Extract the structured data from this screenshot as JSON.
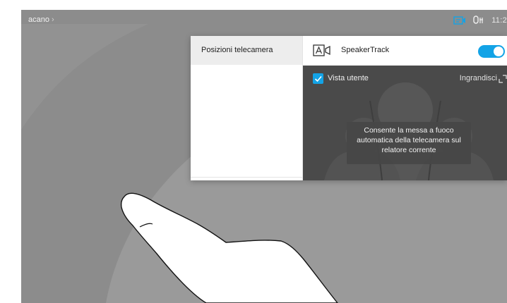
{
  "topbar": {
    "breadcrumb": "acano",
    "breadcrumb_chevron": "›",
    "time": "11:2",
    "icons": [
      "screen-share-icon",
      "mic-status-icon"
    ]
  },
  "panel": {
    "left_item": "Posizioni telecamera",
    "speakertrack": {
      "label": "SpeakerTrack",
      "enabled": true,
      "icon": "camera-tracking-icon"
    },
    "preview": {
      "checkbox_label": "Vista utente",
      "checked": true,
      "zoom_label": "Ingrandisci",
      "tooltip": "Consente la messa a fuoco automatica della telecamera sul relatore corrente"
    }
  },
  "colors": {
    "accent": "#13a3e6",
    "screen_bg": "#8a8a8a",
    "preview_bg": "#4a4a4a"
  }
}
